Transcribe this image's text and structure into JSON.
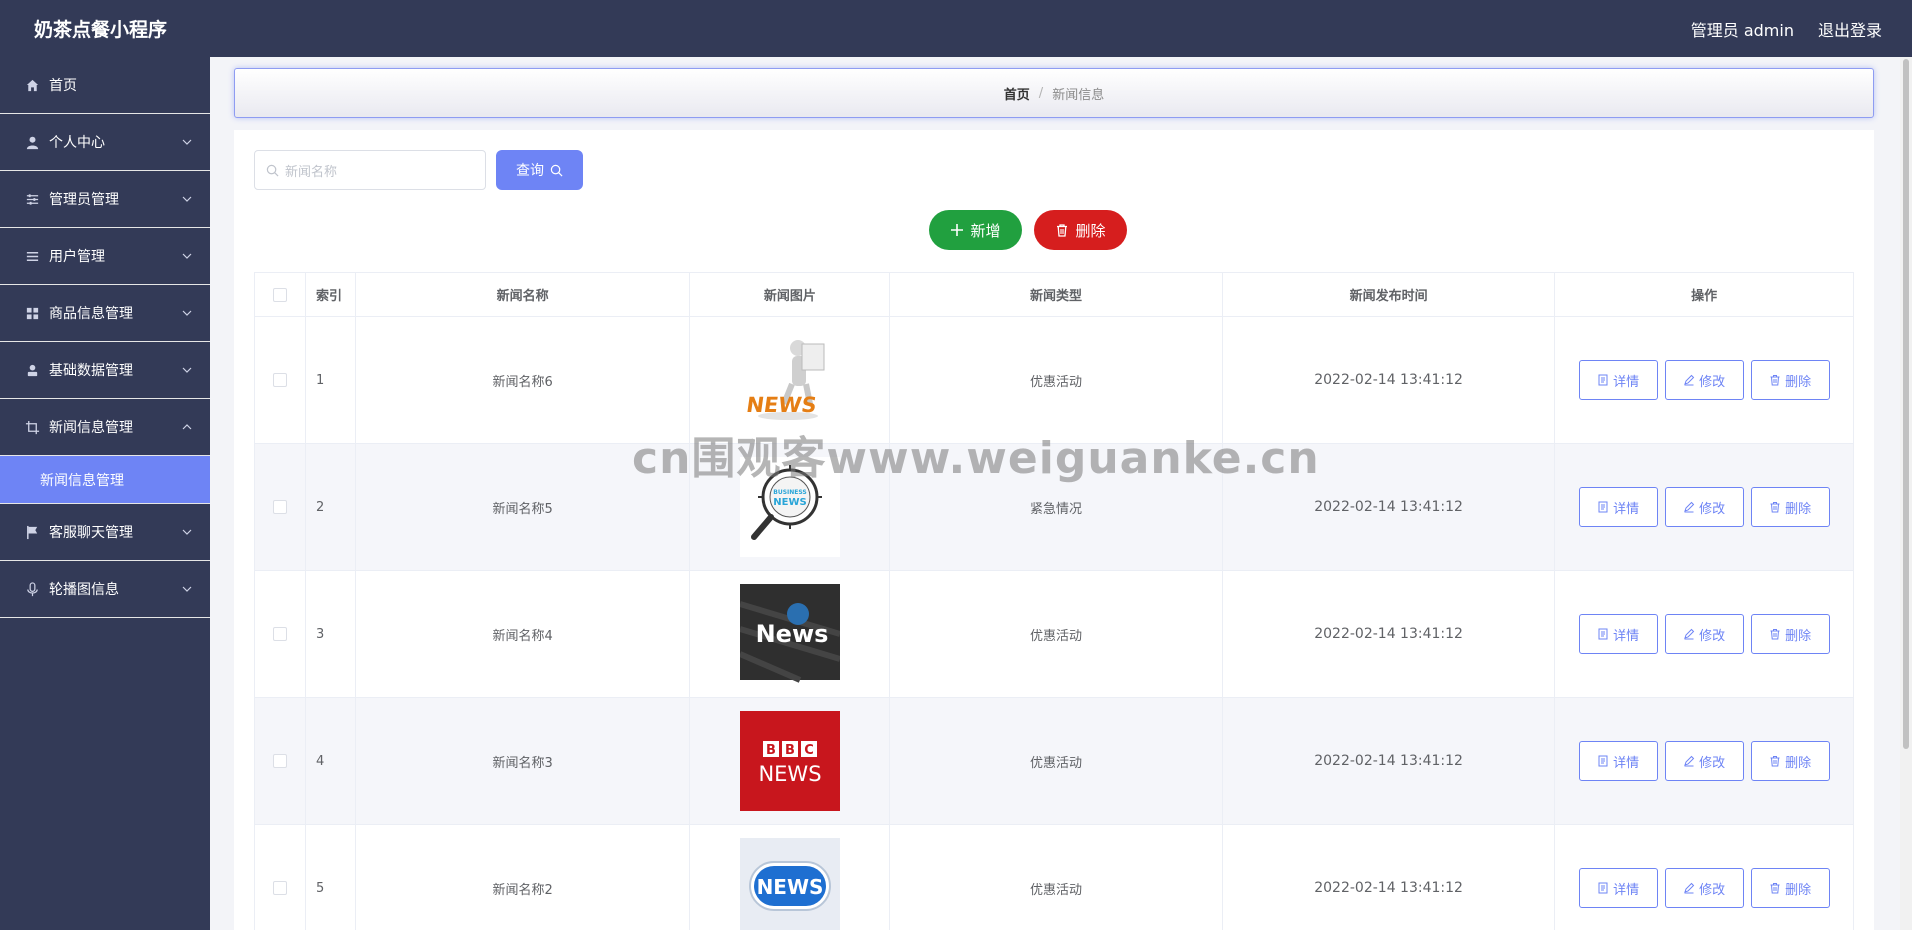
{
  "app": {
    "title": "奶茶点餐小程序"
  },
  "topbar": {
    "user_label": "管理员 admin",
    "logout_label": "退出登录"
  },
  "sidebar": {
    "items": [
      {
        "label": "首页",
        "icon": "home-icon"
      },
      {
        "label": "个人中心",
        "icon": "user-icon"
      },
      {
        "label": "管理员管理",
        "icon": "sliders-icon"
      },
      {
        "label": "用户管理",
        "icon": "list-icon"
      },
      {
        "label": "商品信息管理",
        "icon": "grid-icon"
      },
      {
        "label": "基础数据管理",
        "icon": "person-icon"
      },
      {
        "label": "新闻信息管理",
        "icon": "crop-icon"
      },
      {
        "label": "客服聊天管理",
        "icon": "flag-icon"
      },
      {
        "label": "轮播图信息",
        "icon": "mic-icon"
      }
    ],
    "submenu": {
      "label": "新闻信息管理"
    }
  },
  "breadcrumb": {
    "home": "首页",
    "separator": "/",
    "current": "新闻信息"
  },
  "search": {
    "placeholder": "新闻名称",
    "button_label": "查询"
  },
  "actions": {
    "add_label": "新增",
    "delete_label": "删除"
  },
  "table": {
    "headers": {
      "index": "索引",
      "name": "新闻名称",
      "image": "新闻图片",
      "type": "新闻类型",
      "time": "新闻发布时间",
      "ops": "操作"
    },
    "op_labels": {
      "detail": "详情",
      "edit": "修改",
      "delete": "删除"
    },
    "rows": [
      {
        "index": "1",
        "name": "新闻名称6",
        "image": "news-3d-figure",
        "type": "优惠活动",
        "time": "2022-02-14 13:41:12"
      },
      {
        "index": "2",
        "name": "新闻名称5",
        "image": "business-news-magnifier",
        "type": "紧急情况",
        "time": "2022-02-14 13:41:12"
      },
      {
        "index": "3",
        "name": "新闻名称4",
        "image": "news-dark-globe",
        "type": "优惠活动",
        "time": "2022-02-14 13:41:12"
      },
      {
        "index": "4",
        "name": "新闻名称3",
        "image": "bbc-news",
        "type": "优惠活动",
        "time": "2022-02-14 13:41:12"
      },
      {
        "index": "5",
        "name": "新闻名称2",
        "image": "news-blue-button",
        "type": "优惠活动",
        "time": "2022-02-14 13:41:12"
      }
    ]
  },
  "watermark": "cn围观客www.weiguanke.cn",
  "colors": {
    "sidebar_bg": "#333a57",
    "accent": "#6e84f5",
    "add_green": "#21a03f",
    "delete_red": "#d61e1e"
  }
}
